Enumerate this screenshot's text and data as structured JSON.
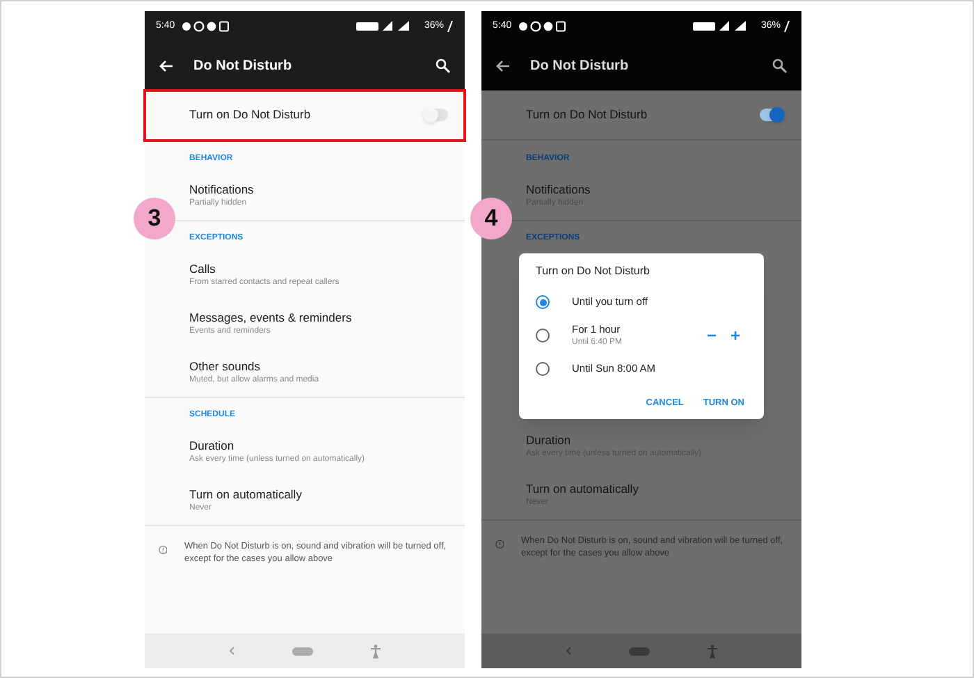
{
  "screens": [
    {
      "step": "3",
      "dimmed": false,
      "status_bar": {
        "time": "5:40",
        "battery": "36%"
      },
      "title": "Do Not Disturb",
      "toggle": {
        "label": "Turn on Do Not Disturb",
        "on": false,
        "highlighted": true
      },
      "blocks": [
        {
          "kind": "header",
          "label": "BEHAVIOR"
        },
        {
          "kind": "item",
          "title": "Notifications",
          "subtitle": "Partially hidden"
        },
        {
          "kind": "header",
          "label": "EXCEPTIONS"
        },
        {
          "kind": "item",
          "title": "Calls",
          "subtitle": "From starred contacts and repeat callers"
        },
        {
          "kind": "item",
          "title": "Messages, events & reminders",
          "subtitle": "Events and reminders"
        },
        {
          "kind": "item",
          "title": "Other sounds",
          "subtitle": "Muted, but allow alarms and media"
        },
        {
          "kind": "header",
          "label": "SCHEDULE"
        },
        {
          "kind": "item",
          "title": "Duration",
          "subtitle": "Ask every time (unless turned on automatically)"
        },
        {
          "kind": "item",
          "title": "Turn on automatically",
          "subtitle": "Never"
        },
        {
          "kind": "info",
          "text": "When Do Not Disturb is on, sound and vibration will be turned off, except for the cases you allow above"
        }
      ]
    },
    {
      "step": "4",
      "dimmed": true,
      "status_bar": {
        "time": "5:40",
        "battery": "36%"
      },
      "title": "Do Not Disturb",
      "toggle": {
        "label": "Turn on Do Not Disturb",
        "on": true,
        "highlighted": false
      },
      "blocks": [
        {
          "kind": "header",
          "label": "BEHAVIOR"
        },
        {
          "kind": "item",
          "title": "Notifications",
          "subtitle": "Partially hidden"
        },
        {
          "kind": "header",
          "label": "EXCEPTIONS"
        },
        {
          "kind": "dialog",
          "title": "Turn on Do Not Disturb",
          "options": [
            {
              "label": "Until you turn off",
              "selected": true
            },
            {
              "label": "For 1 hour",
              "sublabel": "Until 6:40 PM",
              "selected": false,
              "stepper": [
                "−",
                "+"
              ]
            },
            {
              "label": "Until Sun 8:00 AM",
              "selected": false
            }
          ],
          "buttons": [
            "CANCEL",
            "TURN ON"
          ]
        },
        {
          "kind": "item",
          "title": "Duration",
          "subtitle": "Ask every time (unless turned on automatically)"
        },
        {
          "kind": "item",
          "title": "Turn on automatically",
          "subtitle": "Never"
        },
        {
          "kind": "info",
          "text": "When Do Not Disturb is on, sound and vibration will be turned off, except for the cases you allow above"
        }
      ]
    }
  ]
}
